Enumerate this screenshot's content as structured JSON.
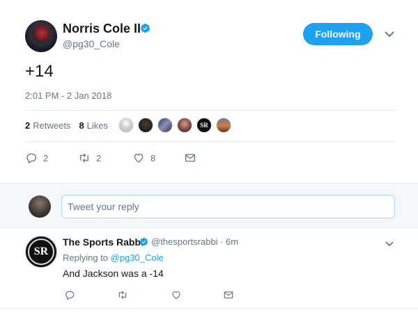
{
  "tweet": {
    "author_name": "Norris Cole II",
    "author_handle": "@pg30_Cole",
    "follow_label": "Following",
    "text": "+14",
    "timestamp": "2:01 PM - 2 Jan 2018",
    "stats": {
      "retweets_count": "2",
      "retweets_label": "Retweets",
      "likes_count": "8",
      "likes_label": "Likes"
    },
    "actions": {
      "reply_count": "2",
      "retweet_count": "2",
      "like_count": "8"
    }
  },
  "reply_box": {
    "placeholder": "Tweet your reply"
  },
  "reply_tweet": {
    "author_name": "The Sports Rabbi",
    "author_handle": "@thesportsrabbi",
    "separator": "·",
    "time": "6m",
    "replying_prefix": "Replying to",
    "replying_to": "@pg30_Cole",
    "text": "And Jackson was a -14",
    "avatar_initials": "SR"
  },
  "colors": {
    "accent": "#1da1f2",
    "secondary_text": "#657786",
    "divider": "#e6ecf0"
  },
  "icons": {
    "verified": "verified-badge-icon",
    "caret": "chevron-down-icon",
    "reply": "reply-icon",
    "retweet": "retweet-icon",
    "like": "heart-icon",
    "dm": "envelope-icon"
  }
}
